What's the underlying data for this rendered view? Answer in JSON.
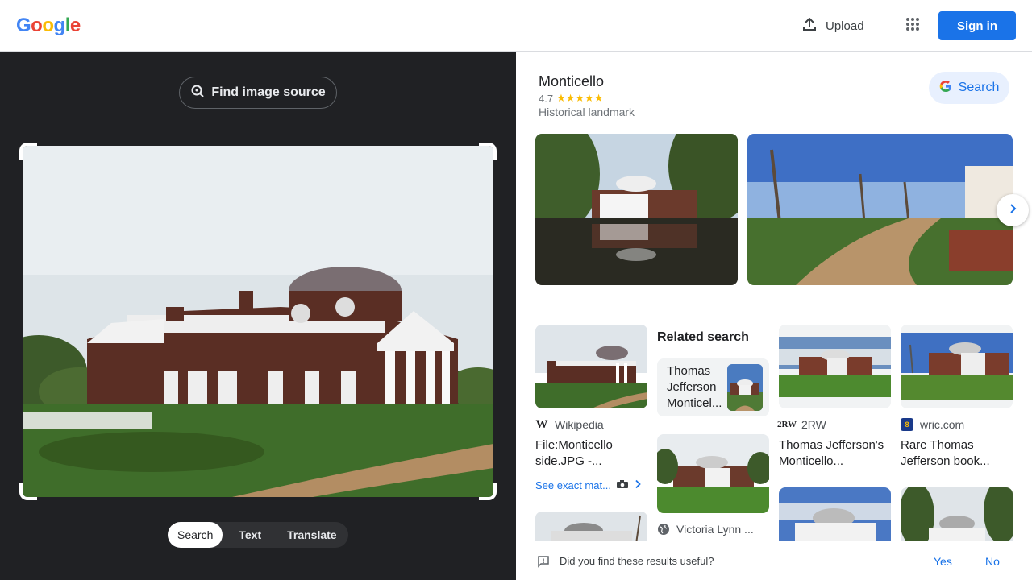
{
  "header": {
    "logo_letters": [
      "G",
      "o",
      "o",
      "g",
      "l",
      "e"
    ],
    "logo_colors": [
      "#4285f4",
      "#ea4335",
      "#fbbc05",
      "#4285f4",
      "#34a853",
      "#ea4335"
    ],
    "upload_label": "Upload",
    "signin_label": "Sign in"
  },
  "lens": {
    "find_source_label": "Find image source",
    "tabs": [
      {
        "label": "Search",
        "active": true
      },
      {
        "label": "Text",
        "active": false
      },
      {
        "label": "Translate",
        "active": false
      }
    ]
  },
  "knowledge_panel": {
    "title": "Monticello",
    "rating": "4.7",
    "stars": "★★★★★",
    "type": "Historical landmark",
    "search_label": "Search"
  },
  "results": {
    "related_header": "Related search",
    "related_chip_text": "Thomas Jefferson Monticel...",
    "items": [
      {
        "source": "Wikipedia",
        "title": "File:Monticello side.JPG -...",
        "see_exact": "See exact mat..."
      },
      {
        "source": "2RW",
        "title": "Thomas Jefferson's Monticello..."
      },
      {
        "source": "wric.com",
        "title": "Rare Thomas Jefferson book..."
      },
      {
        "source": "Victoria Lynn ...",
        "title": ""
      }
    ]
  },
  "feedback": {
    "question": "Did you find these results useful?",
    "yes": "Yes",
    "no": "No"
  },
  "colors": {
    "accent": "#1a73e8",
    "dark_bg": "#202124"
  }
}
